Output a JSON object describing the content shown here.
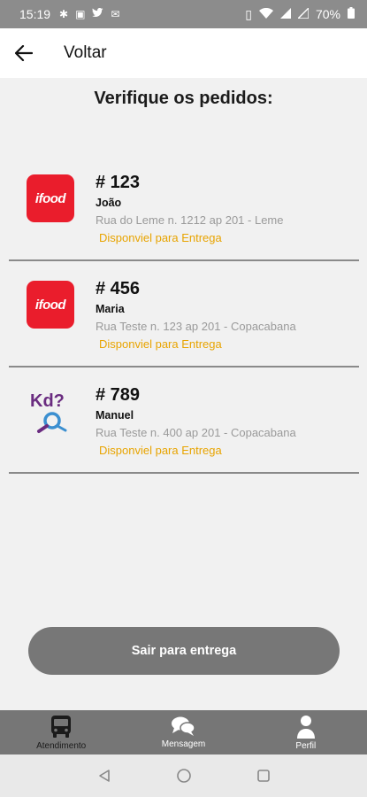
{
  "status_bar": {
    "time": "15:19",
    "battery": "70%"
  },
  "app_bar": {
    "back_icon": "arrow-left-icon",
    "title": "Voltar"
  },
  "heading": "Verifique os pedidos:",
  "orders": [
    {
      "logo": "ifood",
      "logo_text": "ifood",
      "number": "# 123",
      "customer": "João",
      "address": "Rua do Leme n. 1212 ap 201 - Leme",
      "status": "Disponviel para Entrega"
    },
    {
      "logo": "ifood",
      "logo_text": "ifood",
      "number": "# 456",
      "customer": "Maria",
      "address": "Rua Teste n. 123 ap 201 - Copacabana",
      "status": "Disponviel para Entrega"
    },
    {
      "logo": "kd",
      "logo_text": "Kd?",
      "number": "# 789",
      "customer": "Manuel",
      "address": "Rua Teste n. 400 ap 201 - Copacabana",
      "status": "Disponviel para Entrega"
    }
  ],
  "main_button": "Sair para entrega",
  "bottom_nav": [
    {
      "label": "Atendimento",
      "icon": "bus-icon",
      "active": true
    },
    {
      "label": "Mensagem",
      "icon": "chat-icon",
      "active": false
    },
    {
      "label": "Perfil",
      "icon": "person-icon",
      "active": false
    }
  ],
  "colors": {
    "status": "#e8a400",
    "ifood_red": "#ea1d2c",
    "button": "#777777",
    "nav_bg": "#767676"
  }
}
